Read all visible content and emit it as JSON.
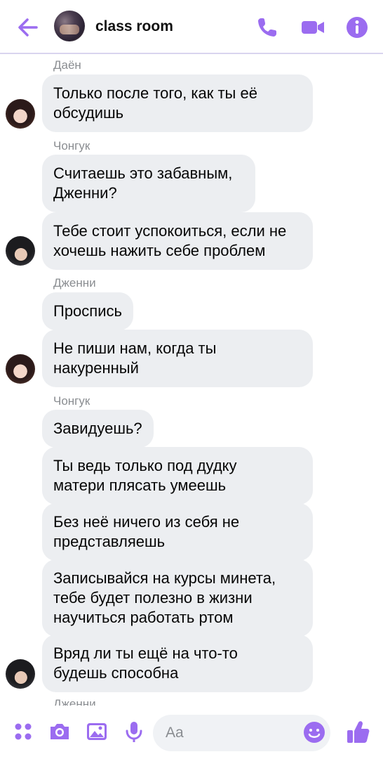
{
  "header": {
    "title": "class room",
    "back_icon": "arrow-left-icon",
    "actions": [
      "phone-icon",
      "video-camera-icon",
      "info-icon"
    ]
  },
  "messages": [
    {
      "sender": "Даён",
      "text": "Только после того, как ты её\nобсудишь"
    },
    {
      "sender": "Чонгук",
      "text": "Считаешь это забавным,\nДженни?"
    },
    {
      "text": "Тебе стоит успокоиться, если не\nхочешь нажить себе проблем"
    },
    {
      "sender": "Дженни",
      "text": "Проспись"
    },
    {
      "text": "Не пиши нам, когда ты\nнакуренный"
    },
    {
      "sender": "Чонгук",
      "text": "Завидуешь?"
    },
    {
      "text": "Ты ведь только под дудку\nматери плясать умеешь"
    },
    {
      "text": "Без неё ничего из себя не\nпредставляешь"
    },
    {
      "text": "Записывайся на курсы минета,\nтебе будет полезно в жизни\nнаучиться работать ртом"
    },
    {
      "text": "Вряд ли ты ещё на что-то\nбудешь способна"
    },
    {
      "sender": "Дженни"
    }
  ],
  "composer": {
    "placeholder": "Aa",
    "icons": [
      "four-dots-icon",
      "camera-icon",
      "image-icon",
      "microphone-icon",
      "emoji-icon",
      "thumbs-up-icon"
    ]
  },
  "colors": {
    "accent": "#9b6cf0",
    "bubble": "#eceef1",
    "sender_text": "#8a8d91"
  }
}
